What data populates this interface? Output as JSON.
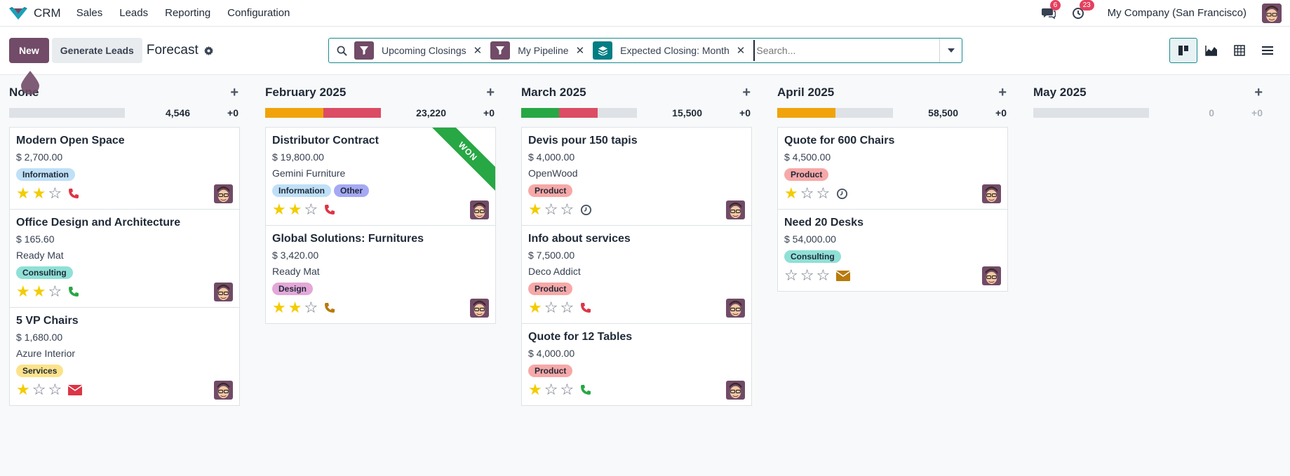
{
  "app": {
    "name": "CRM"
  },
  "menu": [
    "Sales",
    "Leads",
    "Reporting",
    "Configuration"
  ],
  "nav": {
    "messages_count": "6",
    "activities_count": "23",
    "company": "My Company (San Francisco)"
  },
  "control": {
    "new_label": "New",
    "generate_label": "Generate Leads",
    "title": "Forecast"
  },
  "search": {
    "facets": [
      {
        "icon": "filter-icon",
        "label": "Upcoming Closings",
        "color": "#714b67"
      },
      {
        "icon": "filter-icon",
        "label": "My Pipeline",
        "color": "#714b67"
      },
      {
        "icon": "layers-icon",
        "label": "Expected Closing: Month",
        "color": "#017e84"
      }
    ],
    "placeholder": "Search..."
  },
  "colors": {
    "brand": "#714b67",
    "won": "#28a745",
    "progress_orange": "#f0a30a",
    "progress_red": "#dc4c64",
    "progress_green": "#28a745"
  },
  "columns": [
    {
      "title": "None",
      "sum": "4,546",
      "plus": "+0",
      "progress": [],
      "cards": [
        {
          "title": "Modern Open Space",
          "amount": "$ 2,700.00",
          "customer": "",
          "tags": [
            {
              "label": "Information",
              "color": "#bfe0f7"
            }
          ],
          "stars": 2,
          "activity": "phone-icon",
          "activity_color": "#dc3545"
        },
        {
          "title": "Office Design and Architecture",
          "amount": "$ 165.60",
          "customer": "Ready Mat",
          "tags": [
            {
              "label": "Consulting",
              "color": "#8fe0d6"
            }
          ],
          "stars": 2,
          "activity": "phone-icon",
          "activity_color": "#28a745"
        },
        {
          "title": "5 VP Chairs",
          "amount": "$ 1,680.00",
          "customer": "Azure Interior",
          "tags": [
            {
              "label": "Services",
              "color": "#fce38a"
            }
          ],
          "stars": 1,
          "activity": "envelope-icon",
          "activity_color": "#dc3545"
        }
      ]
    },
    {
      "title": "February 2025",
      "sum": "23,220",
      "plus": "+0",
      "progress": [
        {
          "color": "#f0a30a",
          "fraction": 0.5
        },
        {
          "color": "#dc4c64",
          "fraction": 0.5
        }
      ],
      "cards": [
        {
          "title": "Distributor Contract",
          "amount": "$ 19,800.00",
          "customer": "Gemini Furniture",
          "tags": [
            {
              "label": "Information",
              "color": "#bfe0f7"
            },
            {
              "label": "Other",
              "color": "#a5a9f4"
            }
          ],
          "stars": 2,
          "activity": "phone-icon",
          "activity_color": "#dc3545",
          "ribbon": "WON"
        },
        {
          "title": "Global Solutions: Furnitures",
          "amount": "$ 3,420.00",
          "customer": "Ready Mat",
          "tags": [
            {
              "label": "Design",
              "color": "#e3a8d8"
            }
          ],
          "stars": 2,
          "activity": "phone-icon",
          "activity_color": "#b77b0c"
        }
      ]
    },
    {
      "title": "March 2025",
      "sum": "15,500",
      "plus": "+0",
      "progress": [
        {
          "color": "#28a745",
          "fraction": 0.33
        },
        {
          "color": "#dc4c64",
          "fraction": 0.33
        }
      ],
      "cards": [
        {
          "title": "Devis pour 150 tapis",
          "amount": "$ 4,000.00",
          "customer": "OpenWood",
          "tags": [
            {
              "label": "Product",
              "color": "#f7a8a8"
            }
          ],
          "stars": 1,
          "activity": "clock-icon",
          "activity_color": "#4b5563"
        },
        {
          "title": "Info about services",
          "amount": "$ 7,500.00",
          "customer": "Deco Addict",
          "tags": [
            {
              "label": "Product",
              "color": "#f7a8a8"
            }
          ],
          "stars": 1,
          "activity": "phone-icon",
          "activity_color": "#dc3545"
        },
        {
          "title": "Quote for 12 Tables",
          "amount": "$ 4,000.00",
          "customer": "",
          "tags": [
            {
              "label": "Product",
              "color": "#f7a8a8"
            }
          ],
          "stars": 1,
          "activity": "phone-icon",
          "activity_color": "#28a745"
        }
      ]
    },
    {
      "title": "April 2025",
      "sum": "58,500",
      "plus": "+0",
      "progress": [
        {
          "color": "#f0a30a",
          "fraction": 0.5
        }
      ],
      "cards": [
        {
          "title": "Quote for 600 Chairs",
          "amount": "$ 4,500.00",
          "customer": "",
          "tags": [
            {
              "label": "Product",
              "color": "#f7a8a8"
            }
          ],
          "stars": 1,
          "activity": "clock-icon",
          "activity_color": "#4b5563"
        },
        {
          "title": "Need 20 Desks",
          "amount": "$ 54,000.00",
          "customer": "",
          "tags": [
            {
              "label": "Consulting",
              "color": "#8fe0d6"
            }
          ],
          "stars": 0,
          "activity": "envelope-icon",
          "activity_color": "#b77b0c"
        }
      ]
    },
    {
      "title": "May 2025",
      "sum": "0",
      "plus": "+0",
      "progress": [],
      "cards": []
    }
  ]
}
